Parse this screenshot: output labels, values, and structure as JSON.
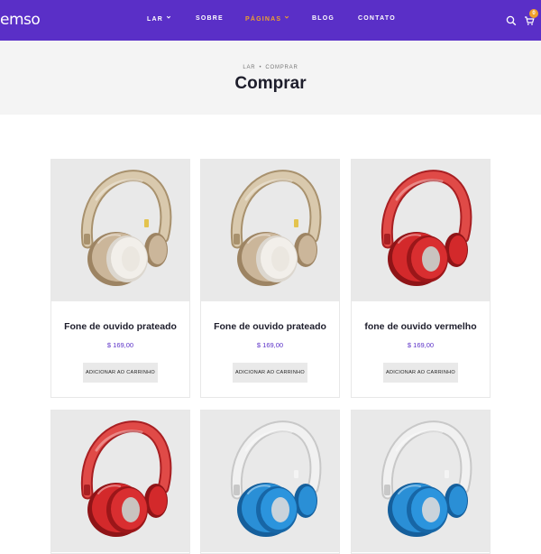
{
  "header": {
    "logo": "emso",
    "nav": [
      {
        "label": "LAR",
        "caret": true,
        "active": false
      },
      {
        "label": "SOBRE",
        "caret": false,
        "active": false
      },
      {
        "label": "PÁGINAS",
        "caret": true,
        "active": true
      },
      {
        "label": "BLOG",
        "caret": false,
        "active": false
      },
      {
        "label": "CONTATO",
        "caret": false,
        "active": false
      }
    ],
    "cart_count": "0",
    "icons": [
      "search-icon",
      "cart-icon",
      "chevron-down-icon"
    ],
    "colors": {
      "bar": "#5a2fc7",
      "active": "#f0a12b"
    }
  },
  "page": {
    "breadcrumb": [
      "LAR",
      "COMPRAR"
    ],
    "title": "Comprar"
  },
  "products": [
    {
      "name": "Fone de ouvido prateado",
      "price": "$ 169,00",
      "button": "ADICIONAR AO CARRINHO",
      "color": "gold"
    },
    {
      "name": "Fone de ouvido prateado",
      "price": "$ 169,00",
      "button": "ADICIONAR AO CARRINHO",
      "color": "gold"
    },
    {
      "name": "fone de ouvido vermelho",
      "price": "$ 169,00",
      "button": "ADICIONAR AO CARRINHO",
      "color": "red"
    },
    {
      "name": "",
      "price": "",
      "button": "",
      "color": "red"
    },
    {
      "name": "",
      "price": "",
      "button": "",
      "color": "blue"
    },
    {
      "name": "",
      "price": "",
      "button": "",
      "color": "blue"
    }
  ]
}
